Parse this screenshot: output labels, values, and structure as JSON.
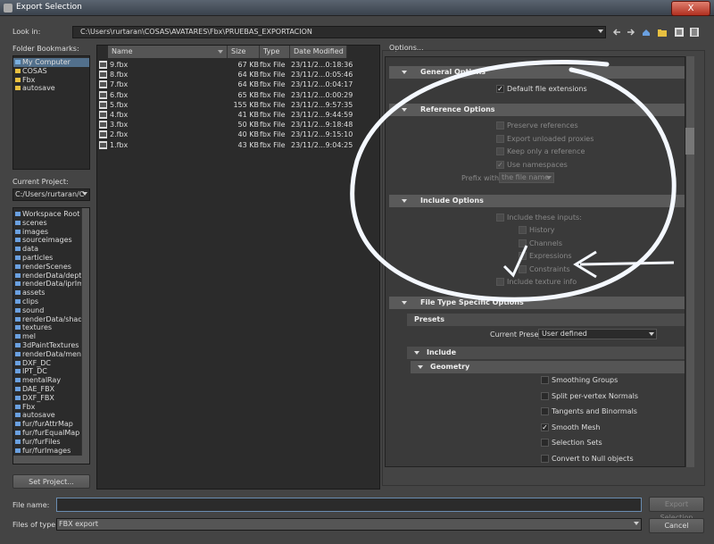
{
  "window": {
    "title": "Export Selection",
    "close_label": "X"
  },
  "lookin": {
    "label": "Look in:",
    "path": "C:\\Users\\rurtaran\\COSAS\\AVATARES\\Fbx\\PRUEBAS_EXPORTACION"
  },
  "bookmarks": {
    "label": "Folder Bookmarks:",
    "items": [
      "My Computer",
      "COSAS",
      "Fbx",
      "autosave"
    ]
  },
  "project": {
    "label": "Current Project:",
    "value": "C:/Users/rurtaran/C",
    "items": [
      "Workspace Root",
      "scenes",
      "images",
      "sourceimages",
      "data",
      "particles",
      "renderScenes",
      "renderData/depth",
      "renderData/iprIma",
      "assets",
      "clips",
      "sound",
      "renderData/shade",
      "textures",
      "mel",
      "3dPaintTextures",
      "renderData/menta",
      "DXF_DC",
      "IPT_DC",
      "mentalRay",
      "DAE_FBX",
      "DXF_FBX",
      "Fbx",
      "autosave",
      "fur/furAttrMap",
      "fur/furEqualMap",
      "fur/furFiles",
      "fur/furImages"
    ],
    "set_button": "Set Project..."
  },
  "files": {
    "headers": [
      "Name",
      "Size",
      "Type",
      "Date Modified"
    ],
    "rows": [
      [
        "9.fbx",
        "67 KB",
        "fbx File",
        "23/11/2...0:18:36"
      ],
      [
        "8.fbx",
        "64 KB",
        "fbx File",
        "23/11/2...0:05:46"
      ],
      [
        "7.fbx",
        "64 KB",
        "fbx File",
        "23/11/2...0:04:17"
      ],
      [
        "6.fbx",
        "65 KB",
        "fbx File",
        "23/11/2...0:00:29"
      ],
      [
        "5.fbx",
        "155 KB",
        "fbx File",
        "23/11/2...9:57:35"
      ],
      [
        "4.fbx",
        "41 KB",
        "fbx File",
        "23/11/2...9:44:59"
      ],
      [
        "3.fbx",
        "50 KB",
        "fbx File",
        "23/11/2...9:18:48"
      ],
      [
        "2.fbx",
        "40 KB",
        "fbx File",
        "23/11/2...9:15:10"
      ],
      [
        "1.fbx",
        "43 KB",
        "fbx File",
        "23/11/2...9:04:25"
      ]
    ]
  },
  "options": {
    "label": "Options...",
    "general": {
      "title": "General Options",
      "default_ext": "Default file extensions"
    },
    "reference": {
      "title": "Reference Options",
      "items": [
        "Preserve references",
        "Export unloaded proxies",
        "Keep only a reference",
        "Use namespaces"
      ],
      "prefix_label": "Prefix with:",
      "prefix_value": "the file name"
    },
    "include": {
      "title": "Include Options",
      "inputs_label": "Include these inputs:",
      "inputs": [
        "History",
        "Channels",
        "Expressions",
        "Constraints"
      ],
      "texture": "Include texture info"
    },
    "filetype": {
      "title": "File Type Specific Options",
      "presets_title": "Presets",
      "preset_label": "Current Preset:",
      "preset_value": "User defined",
      "include_title": "Include",
      "geometry_title": "Geometry",
      "geometry": [
        "Smoothing Groups",
        "Split per-vertex Normals",
        "Tangents and Binormals",
        "Smooth Mesh",
        "Selection Sets",
        "Convert to Null objects"
      ]
    }
  },
  "bottom": {
    "filename_label": "File name:",
    "filename_value": "",
    "export_button": "Export Selection",
    "filetype_label": "Files of type:",
    "filetype_value": "FBX export",
    "cancel_button": "Cancel"
  }
}
